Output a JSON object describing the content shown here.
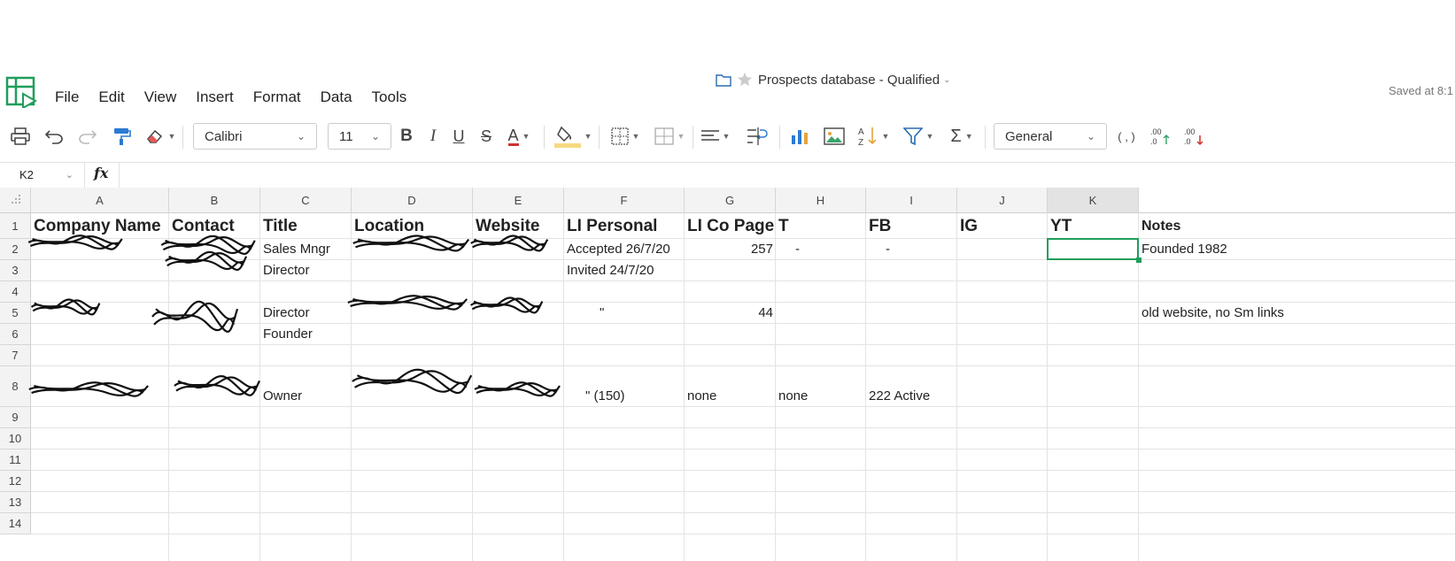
{
  "app": {
    "doc_title": "Prospects database - Qualified",
    "saved_status": "Saved at 8:1",
    "menu": [
      "File",
      "Edit",
      "View",
      "Insert",
      "Format",
      "Data",
      "Tools"
    ]
  },
  "toolbar": {
    "font_name": "Calibri",
    "font_size": "11",
    "number_format": "General",
    "icons": [
      "print-icon",
      "undo-icon",
      "redo-icon",
      "format-painter-icon",
      "clear-format-icon",
      "bold-icon",
      "italic-icon",
      "underline-icon",
      "strikethrough-icon",
      "text-color-icon",
      "fill-color-icon",
      "borders-icon",
      "merge-icon",
      "align-icon",
      "wrap-icon",
      "chart-icon",
      "image-icon",
      "sort-icon",
      "filter-icon",
      "sum-icon",
      "comma-icon",
      "increase-decimal-icon",
      "decrease-decimal-icon"
    ],
    "bold": "B",
    "italic": "I",
    "underline": "U",
    "strike": "S",
    "text_color": "A",
    "comma": "( , )"
  },
  "formula_bar": {
    "cell_ref": "K2",
    "fx": "fx",
    "value": ""
  },
  "sheet": {
    "columns": [
      "A",
      "B",
      "C",
      "D",
      "E",
      "F",
      "G",
      "H",
      "I",
      "J",
      "K"
    ],
    "rows": [
      "1",
      "2",
      "3",
      "4",
      "5",
      "6",
      "7",
      "8",
      "9",
      "10",
      "11",
      "12",
      "13",
      "14"
    ],
    "selected_cell": "K2",
    "cells": {
      "A1": "Company Name",
      "B1": "Contact",
      "C1": "Title",
      "D1": "Location",
      "E1": "Website",
      "F1": "LI Personal",
      "G1": "LI Co Page",
      "H1": "T",
      "I1": "FB",
      "J1": "IG",
      "K1": "YT",
      "L1": "Notes",
      "C2": "Sales Mngr",
      "F2": "Accepted 26/7/20",
      "G2": "257",
      "H2": "-",
      "I2": "-",
      "L2": "Founded 1982",
      "C3": "Director",
      "F3": "Invited 24/7/20",
      "C5": "Director",
      "F5": "\"",
      "G5": "44",
      "L5": "old website, no Sm links",
      "C6": "Founder",
      "C8": "Owner",
      "F8": "\" (150)",
      "G8": "none",
      "H8": "none",
      "I8": "222 Active"
    }
  },
  "colors": {
    "accent_green": "#1f9e5a",
    "text_color_bar": "#d0312d",
    "fill_color_bar": "#f5d982"
  }
}
